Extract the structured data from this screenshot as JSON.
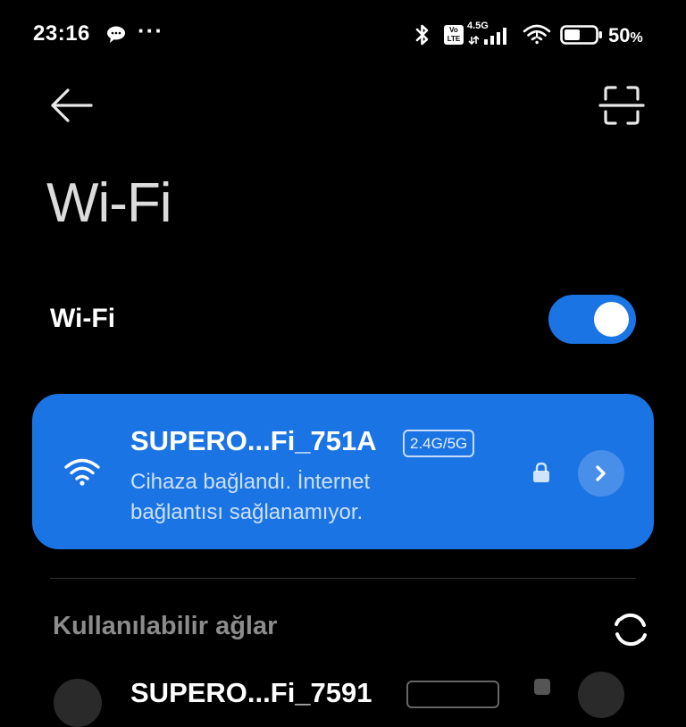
{
  "status_bar": {
    "time": "23:16",
    "more_dots": "···",
    "volte_top": "Vo",
    "volte_bottom": "LTE",
    "network_type": "4.5G",
    "battery_number": "50",
    "battery_symbol": "%",
    "battery_level": 0.5,
    "icons": [
      "chat-bubble-icon",
      "bluetooth-icon",
      "volte-icon",
      "cell-signal-icon",
      "wifi-no-internet-icon",
      "battery-icon"
    ]
  },
  "header": {
    "title": "Wi-Fi",
    "back_icon": "arrow-left-icon",
    "scan_icon": "qr-scan-icon"
  },
  "wifi_toggle": {
    "label": "Wi-Fi",
    "enabled": true
  },
  "connected_network": {
    "name": "SUPERO...Fi_751A",
    "band": "2.4G/5G",
    "status": "Cihaza bağlandı. İnternet bağlantısı sağlanamıyor.",
    "secured": true,
    "icons": [
      "wifi-icon",
      "lock-icon",
      "chevron-right-icon"
    ]
  },
  "available_networks": {
    "title": "Kullanılabilir ağlar",
    "refresh_icon": "refresh-icon",
    "items": [
      {
        "name": "SUPERO...Fi_7591"
      }
    ]
  },
  "colors": {
    "background": "#000000",
    "accent": "#1b74e4",
    "toggle_on": "#1b74e4",
    "title_gray": "#dcdcdc",
    "section_gray": "#8c8c8c"
  }
}
